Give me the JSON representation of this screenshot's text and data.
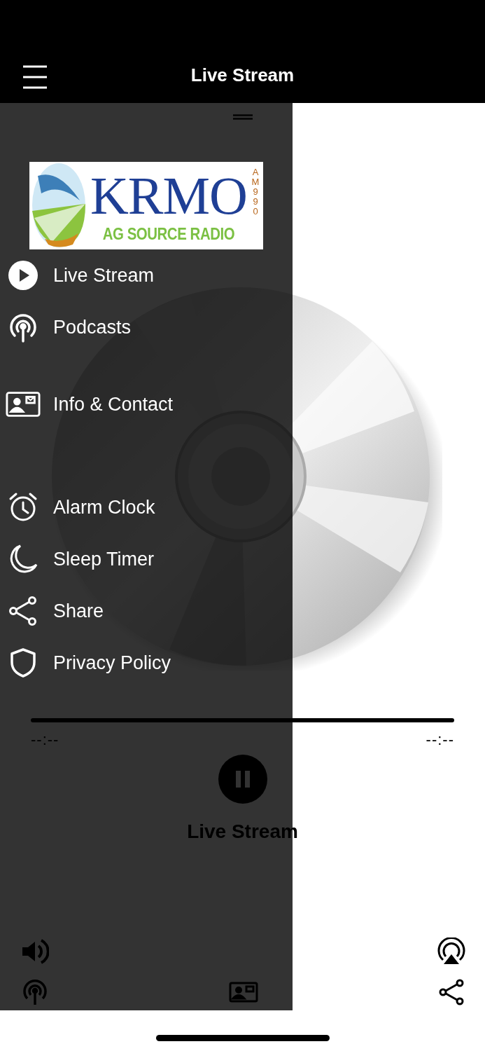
{
  "header": {
    "title": "Live Stream"
  },
  "player": {
    "elapsed": "--:--",
    "remaining": "--:--",
    "playing": true,
    "title": "Live Stream"
  },
  "drawer": {
    "logo": {
      "name": "KRMO",
      "tagline": "AG SOURCE RADIO",
      "band": "AM 990"
    },
    "groups": [
      [
        {
          "kind": "play",
          "label": "Live Stream"
        },
        {
          "kind": "podcast",
          "label": "Podcasts"
        }
      ],
      [
        {
          "kind": "contact",
          "label": "Info & Contact"
        }
      ],
      [
        {
          "kind": "alarm",
          "label": "Alarm Clock"
        },
        {
          "kind": "moon",
          "label": "Sleep Timer"
        },
        {
          "kind": "share",
          "label": "Share"
        },
        {
          "kind": "shield",
          "label": "Privacy Policy"
        }
      ]
    ]
  }
}
